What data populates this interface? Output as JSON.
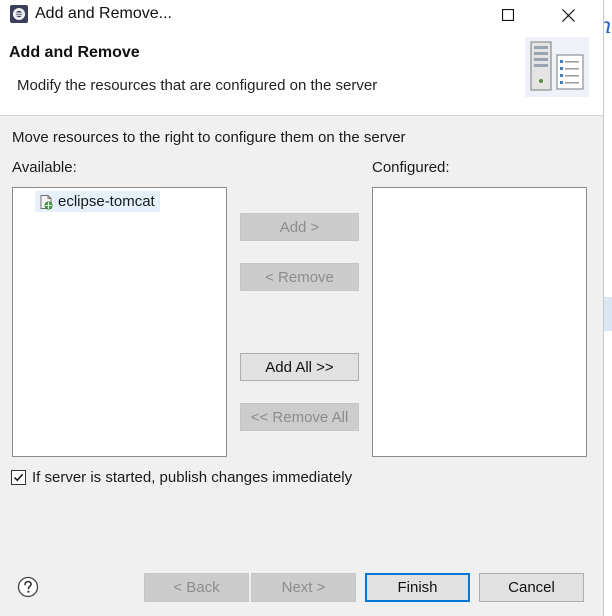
{
  "window": {
    "title": "Add and Remove...",
    "background_peek": "h"
  },
  "header": {
    "title": "Add and Remove",
    "description": "Modify the resources that are configured on the server"
  },
  "main": {
    "instruction": "Move resources to the right to configure them on the server",
    "available_label": "Available:",
    "configured_label": "Configured:",
    "available_items": [
      {
        "label": "eclipse-tomcat",
        "icon": "web-project-icon"
      }
    ],
    "configured_items": [],
    "buttons": {
      "add": {
        "label": "Add >",
        "enabled": false
      },
      "remove": {
        "label": "< Remove",
        "enabled": false
      },
      "add_all": {
        "label": "Add All >>",
        "enabled": true
      },
      "remove_all": {
        "label": "<< Remove All",
        "enabled": false
      }
    },
    "publish_checkbox": {
      "label": "If server is started, publish changes immediately",
      "checked": true
    }
  },
  "footer": {
    "back": {
      "label": "< Back",
      "enabled": false
    },
    "next": {
      "label": "Next >",
      "enabled": false
    },
    "finish": {
      "label": "Finish",
      "enabled": true,
      "default": true
    },
    "cancel": {
      "label": "Cancel",
      "enabled": true
    }
  },
  "colors": {
    "dialog_bg": "#f0f0f0",
    "selection_bg": "#e5f0fb",
    "default_button_border": "#0078d7"
  }
}
